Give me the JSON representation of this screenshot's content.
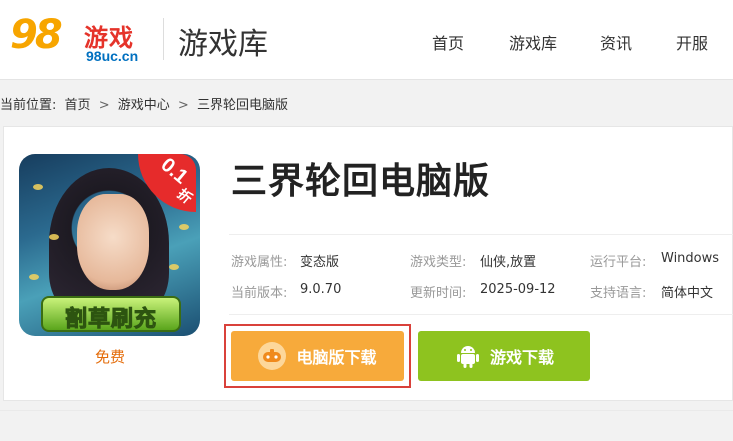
{
  "header": {
    "logo": {
      "number": "98",
      "title": "游戏",
      "url": "98uc.cn"
    },
    "section_title": "游戏库",
    "nav": [
      "首页",
      "游戏库",
      "资讯",
      "开服"
    ]
  },
  "breadcrumb": {
    "prefix": "当前位置:",
    "items": [
      "首页",
      "游戏中心",
      "三界轮回电脑版"
    ],
    "separator": ">"
  },
  "game": {
    "title": "三界轮回电脑版",
    "price": "免费",
    "icon": {
      "badge": "0.1",
      "badge_unit": "折",
      "banner": "割草刷充"
    },
    "info": [
      {
        "label": "游戏属性:",
        "value": "变态版"
      },
      {
        "label": "游戏类型:",
        "value": "仙侠,放置"
      },
      {
        "label": "运行平台:",
        "value": "Windows"
      },
      {
        "label": "当前版本:",
        "value": "9.0.70"
      },
      {
        "label": "更新时间:",
        "value": "2025-09-12"
      },
      {
        "label": "支持语言:",
        "value": "简体中文"
      }
    ]
  },
  "buttons": {
    "pc_download": "电脑版下载",
    "game_download": "游戏下载"
  },
  "colors": {
    "pc_button": "#f7aa3b",
    "game_button": "#8ec31f",
    "highlight_outline": "#d9413b",
    "price": "#e46c0a"
  }
}
